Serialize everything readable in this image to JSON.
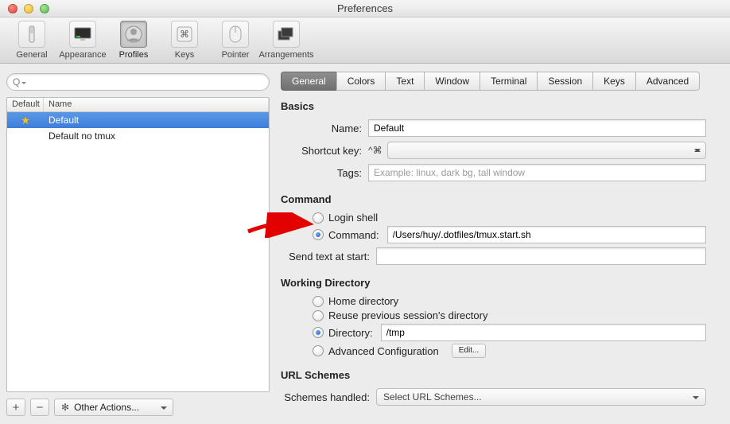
{
  "window": {
    "title": "Preferences"
  },
  "toolbar": {
    "items": [
      {
        "label": "General",
        "name": "tb-general"
      },
      {
        "label": "Appearance",
        "name": "tb-appearance"
      },
      {
        "label": "Profiles",
        "name": "tb-profiles",
        "selected": true
      },
      {
        "label": "Keys",
        "name": "tb-keys"
      },
      {
        "label": "Pointer",
        "name": "tb-pointer"
      },
      {
        "label": "Arrangements",
        "name": "tb-arrangements"
      }
    ]
  },
  "left": {
    "search_placeholder": "",
    "columns": [
      "Default",
      "Name"
    ],
    "rows": [
      {
        "default": true,
        "name": "Default",
        "selected": true
      },
      {
        "default": false,
        "name": "Default no tmux",
        "selected": false
      }
    ],
    "plus": "+",
    "minus": "−",
    "gear_label": "Other Actions..."
  },
  "tabs": [
    "General",
    "Colors",
    "Text",
    "Window",
    "Terminal",
    "Session",
    "Keys",
    "Advanced"
  ],
  "active_tab": 0,
  "basics": {
    "heading": "Basics",
    "name_label": "Name:",
    "name_value": "Default",
    "shortcut_label": "Shortcut key:",
    "shortcut_mods": "^⌘",
    "tags_label": "Tags:",
    "tags_placeholder": "Example: linux, dark bg, tall window"
  },
  "command": {
    "heading": "Command",
    "login_shell": "Login shell",
    "command_label": "Command:",
    "command_value": "/Users/huy/.dotfiles/tmux.start.sh",
    "send_text_label": "Send text at start:",
    "send_text_value": ""
  },
  "workdir": {
    "heading": "Working Directory",
    "home": "Home directory",
    "reuse": "Reuse previous session's directory",
    "directory_label": "Directory:",
    "directory_value": "/tmp",
    "advanced": "Advanced Configuration",
    "edit_btn": "Edit..."
  },
  "url": {
    "heading": "URL Schemes",
    "label": "Schemes handled:",
    "combo": "Select URL Schemes..."
  }
}
